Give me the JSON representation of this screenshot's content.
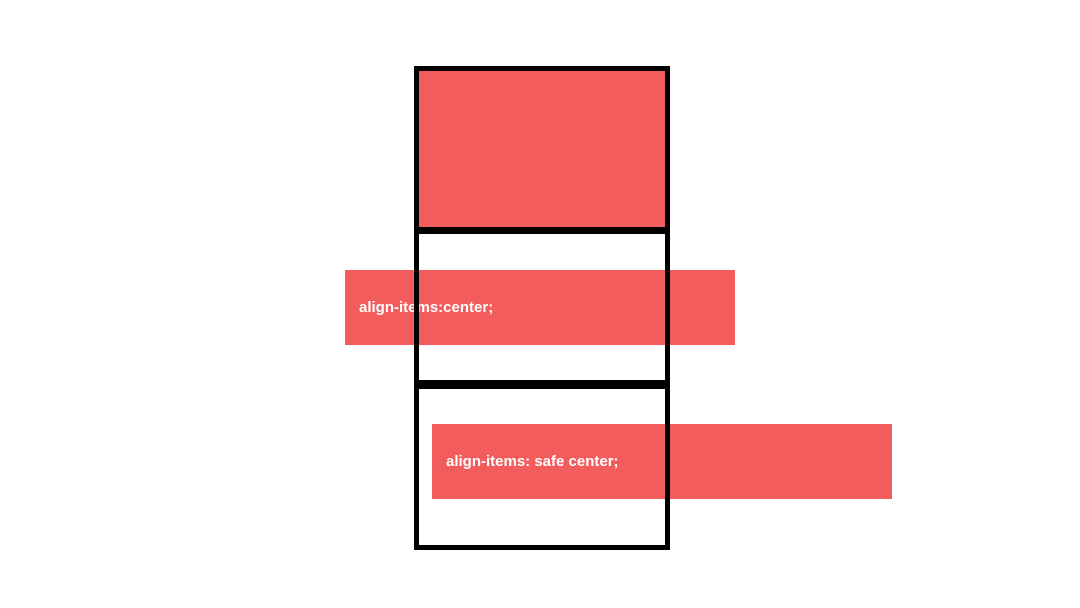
{
  "boxes": {
    "box1": {
      "label": ""
    },
    "box2": {
      "label": "align-items:center;"
    },
    "box3": {
      "label": "align-items: safe center;"
    }
  },
  "colors": {
    "red": "#f25c5c",
    "black": "#000000",
    "white": "#ffffff"
  }
}
